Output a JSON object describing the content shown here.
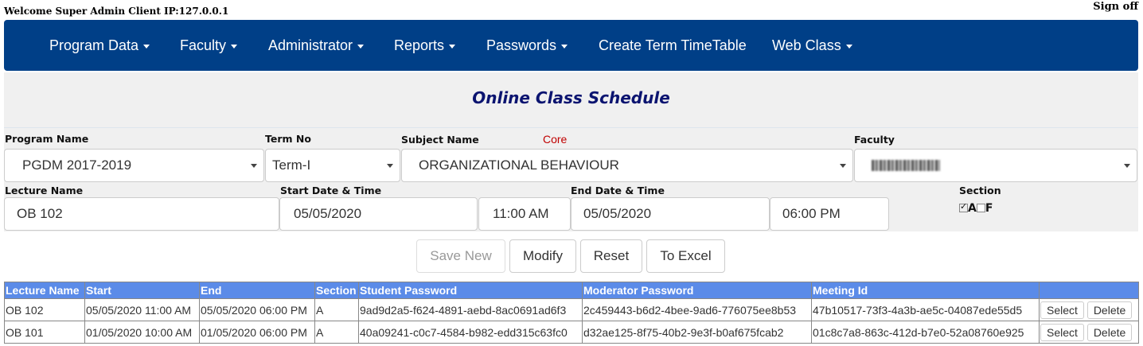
{
  "header": {
    "welcome": "Welcome Super Admin Client IP:127.0.0.1",
    "sign_off": "Sign off"
  },
  "nav": {
    "items": [
      {
        "label": "Program Data",
        "dropdown": true
      },
      {
        "label": "Faculty",
        "dropdown": true
      },
      {
        "label": "Administrator",
        "dropdown": true
      },
      {
        "label": "Reports",
        "dropdown": true
      },
      {
        "label": "Passwords",
        "dropdown": true
      },
      {
        "label": "Create Term TimeTable",
        "dropdown": false
      },
      {
        "label": "Web Class",
        "dropdown": true
      }
    ]
  },
  "page": {
    "title": "Online Class Schedule"
  },
  "form": {
    "program_label": "Program Name",
    "program_value": "PGDM 2017-2019",
    "term_label": "Term No",
    "term_value": "Term-I",
    "subject_label": "Subject Name",
    "subject_tag": "Core",
    "subject_value": "ORGANIZATIONAL BEHAVIOUR",
    "faculty_label": "Faculty",
    "lecture_label": "Lecture Name",
    "lecture_value": "OB 102",
    "start_label": "Start Date & Time",
    "start_date": "05/05/2020",
    "start_time": "11:00 AM",
    "end_label": "End Date & Time",
    "end_date": "05/05/2020",
    "end_time": "06:00 PM",
    "section_label": "Section",
    "sections": [
      {
        "label": "A",
        "checked": true
      },
      {
        "label": "F",
        "checked": false
      }
    ]
  },
  "actions": {
    "save_new": "Save New",
    "modify": "Modify",
    "reset": "Reset",
    "to_excel": "To Excel"
  },
  "table": {
    "headers": [
      "Lecture Name",
      "Start",
      "End",
      "Section",
      "Student Password",
      "Moderator Password",
      "Meeting Id",
      ""
    ],
    "rows": [
      {
        "lecture": "OB 102",
        "start": "05/05/2020 11:00 AM",
        "end": "05/05/2020 06:00 PM",
        "section": "A",
        "student_password": "9ad9d2a5-f624-4891-aebd-8ac0691ad6f3",
        "moderator_password": "2c459443-b6d2-4bee-9ad6-776075ee8b53",
        "meeting_id": "47b10517-73f3-4a3b-ae5c-04087ede55d5",
        "select": "Select",
        "delete": "Delete"
      },
      {
        "lecture": "OB 101",
        "start": "01/05/2020 10:00 AM",
        "end": "01/05/2020 06:00 PM",
        "section": "A",
        "student_password": "40a09241-c0c7-4584-b982-edd315c63fc0",
        "moderator_password": "d32ae125-8f75-40b2-9e3f-b0af675fcab2",
        "meeting_id": "01c8c7a8-863c-412d-b7e0-52a08760e925",
        "select": "Select",
        "delete": "Delete"
      }
    ]
  },
  "colors": {
    "nav_bg": "#003f87",
    "table_header_bg": "#5b8be8",
    "title_color": "#0b1470",
    "core_color": "#c00000"
  }
}
